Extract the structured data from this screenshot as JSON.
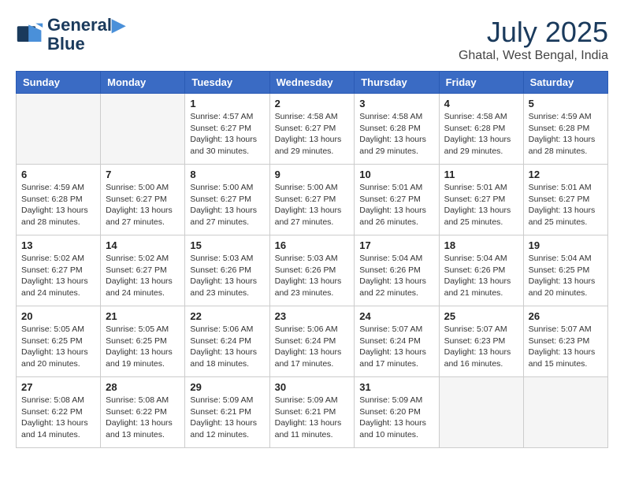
{
  "header": {
    "logo_line1": "General",
    "logo_line2": "Blue",
    "month": "July 2025",
    "location": "Ghatal, West Bengal, India"
  },
  "weekdays": [
    "Sunday",
    "Monday",
    "Tuesday",
    "Wednesday",
    "Thursday",
    "Friday",
    "Saturday"
  ],
  "weeks": [
    [
      {
        "day": "",
        "empty": true
      },
      {
        "day": "",
        "empty": true
      },
      {
        "day": "1",
        "sunrise": "4:57 AM",
        "sunset": "6:27 PM",
        "daylight": "13 hours and 30 minutes."
      },
      {
        "day": "2",
        "sunrise": "4:58 AM",
        "sunset": "6:27 PM",
        "daylight": "13 hours and 29 minutes."
      },
      {
        "day": "3",
        "sunrise": "4:58 AM",
        "sunset": "6:28 PM",
        "daylight": "13 hours and 29 minutes."
      },
      {
        "day": "4",
        "sunrise": "4:58 AM",
        "sunset": "6:28 PM",
        "daylight": "13 hours and 29 minutes."
      },
      {
        "day": "5",
        "sunrise": "4:59 AM",
        "sunset": "6:28 PM",
        "daylight": "13 hours and 28 minutes."
      }
    ],
    [
      {
        "day": "6",
        "sunrise": "4:59 AM",
        "sunset": "6:28 PM",
        "daylight": "13 hours and 28 minutes."
      },
      {
        "day": "7",
        "sunrise": "5:00 AM",
        "sunset": "6:27 PM",
        "daylight": "13 hours and 27 minutes."
      },
      {
        "day": "8",
        "sunrise": "5:00 AM",
        "sunset": "6:27 PM",
        "daylight": "13 hours and 27 minutes."
      },
      {
        "day": "9",
        "sunrise": "5:00 AM",
        "sunset": "6:27 PM",
        "daylight": "13 hours and 27 minutes."
      },
      {
        "day": "10",
        "sunrise": "5:01 AM",
        "sunset": "6:27 PM",
        "daylight": "13 hours and 26 minutes."
      },
      {
        "day": "11",
        "sunrise": "5:01 AM",
        "sunset": "6:27 PM",
        "daylight": "13 hours and 25 minutes."
      },
      {
        "day": "12",
        "sunrise": "5:01 AM",
        "sunset": "6:27 PM",
        "daylight": "13 hours and 25 minutes."
      }
    ],
    [
      {
        "day": "13",
        "sunrise": "5:02 AM",
        "sunset": "6:27 PM",
        "daylight": "13 hours and 24 minutes."
      },
      {
        "day": "14",
        "sunrise": "5:02 AM",
        "sunset": "6:27 PM",
        "daylight": "13 hours and 24 minutes."
      },
      {
        "day": "15",
        "sunrise": "5:03 AM",
        "sunset": "6:26 PM",
        "daylight": "13 hours and 23 minutes."
      },
      {
        "day": "16",
        "sunrise": "5:03 AM",
        "sunset": "6:26 PM",
        "daylight": "13 hours and 23 minutes."
      },
      {
        "day": "17",
        "sunrise": "5:04 AM",
        "sunset": "6:26 PM",
        "daylight": "13 hours and 22 minutes."
      },
      {
        "day": "18",
        "sunrise": "5:04 AM",
        "sunset": "6:26 PM",
        "daylight": "13 hours and 21 minutes."
      },
      {
        "day": "19",
        "sunrise": "5:04 AM",
        "sunset": "6:25 PM",
        "daylight": "13 hours and 20 minutes."
      }
    ],
    [
      {
        "day": "20",
        "sunrise": "5:05 AM",
        "sunset": "6:25 PM",
        "daylight": "13 hours and 20 minutes."
      },
      {
        "day": "21",
        "sunrise": "5:05 AM",
        "sunset": "6:25 PM",
        "daylight": "13 hours and 19 minutes."
      },
      {
        "day": "22",
        "sunrise": "5:06 AM",
        "sunset": "6:24 PM",
        "daylight": "13 hours and 18 minutes."
      },
      {
        "day": "23",
        "sunrise": "5:06 AM",
        "sunset": "6:24 PM",
        "daylight": "13 hours and 17 minutes."
      },
      {
        "day": "24",
        "sunrise": "5:07 AM",
        "sunset": "6:24 PM",
        "daylight": "13 hours and 17 minutes."
      },
      {
        "day": "25",
        "sunrise": "5:07 AM",
        "sunset": "6:23 PM",
        "daylight": "13 hours and 16 minutes."
      },
      {
        "day": "26",
        "sunrise": "5:07 AM",
        "sunset": "6:23 PM",
        "daylight": "13 hours and 15 minutes."
      }
    ],
    [
      {
        "day": "27",
        "sunrise": "5:08 AM",
        "sunset": "6:22 PM",
        "daylight": "13 hours and 14 minutes."
      },
      {
        "day": "28",
        "sunrise": "5:08 AM",
        "sunset": "6:22 PM",
        "daylight": "13 hours and 13 minutes."
      },
      {
        "day": "29",
        "sunrise": "5:09 AM",
        "sunset": "6:21 PM",
        "daylight": "13 hours and 12 minutes."
      },
      {
        "day": "30",
        "sunrise": "5:09 AM",
        "sunset": "6:21 PM",
        "daylight": "13 hours and 11 minutes."
      },
      {
        "day": "31",
        "sunrise": "5:09 AM",
        "sunset": "6:20 PM",
        "daylight": "13 hours and 10 minutes."
      },
      {
        "day": "",
        "empty": true
      },
      {
        "day": "",
        "empty": true
      }
    ]
  ]
}
